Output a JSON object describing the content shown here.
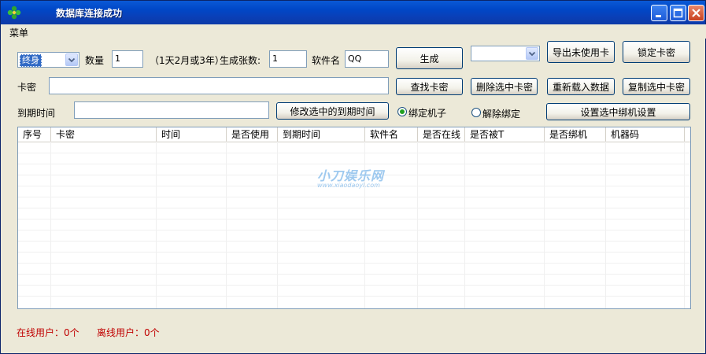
{
  "window": {
    "title": "数据库连接成功",
    "controls": {
      "minimize": "_",
      "maximize": "□",
      "close": "✕"
    }
  },
  "menu": {
    "label": "菜单"
  },
  "row1": {
    "type_select_value": "终身",
    "quantity_label": "数量",
    "quantity_value": "1",
    "hint": "（1天2月或3年）",
    "gen_count_label": "生成张数:",
    "gen_count_value": "1",
    "software_label": "软件名",
    "software_value": "QQ",
    "generate_button": "生成",
    "right_select_value": "",
    "export_button": "导出未使用卡",
    "lock_button": "锁定卡密"
  },
  "row2": {
    "card_label": "卡密",
    "card_value": "",
    "find_button": "查找卡密",
    "delete_button": "删除选中卡密",
    "reload_button": "重新载入数据",
    "copy_button": "复制选中卡密"
  },
  "row3": {
    "expire_label": "到期时间",
    "expire_value": "",
    "modify_expire_button": "修改选中的到期时间",
    "bind_radio_label": "绑定机子",
    "bind_selected": true,
    "unbind_radio_label": "解除绑定",
    "set_bind_button": "设置选中绑机设置"
  },
  "table": {
    "columns": [
      "序号",
      "卡密",
      "时间",
      "是否使用",
      "到期时间",
      "软件名",
      "是否在线",
      "是否被T",
      "是否绑机",
      "机器码"
    ],
    "rows": []
  },
  "watermark": {
    "main": "小刀娱乐网",
    "sub": "www.xiaodaoyl.com"
  },
  "status": {
    "online_users": "在线用户：0个",
    "offline_users": "离线用户：0个"
  },
  "colors": {
    "title_bar": "#0a59d6",
    "status_text": "#c00000",
    "radio_dot": "#21a121",
    "selection": "#316ac5"
  }
}
